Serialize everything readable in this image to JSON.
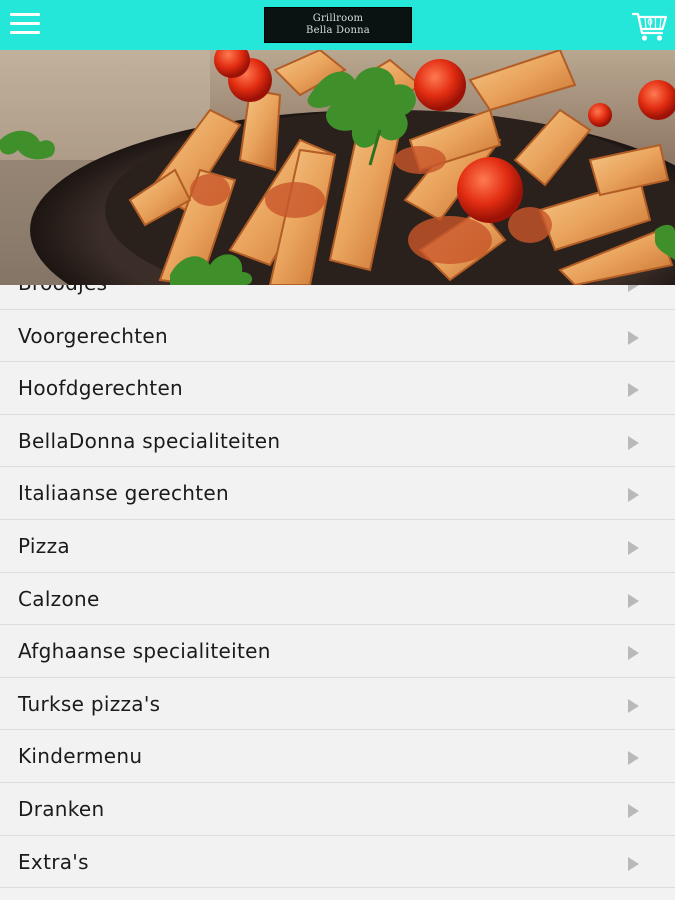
{
  "header": {
    "logo_line1": "Grillroom",
    "logo_line2": "Bella Donna",
    "cart_count": "0",
    "menu_icon": "hamburger-menu-icon",
    "cart_icon": "shopping-cart-icon"
  },
  "colors": {
    "topbar": "#24e6d9",
    "list_background": "#f2f2f2",
    "divider": "#dcdcdc",
    "arrow": "#b9b9b9"
  },
  "categories": [
    {
      "label": "Broodjes"
    },
    {
      "label": "Voorgerechten"
    },
    {
      "label": "Hoofdgerechten"
    },
    {
      "label": "BellaDonna specialiteiten"
    },
    {
      "label": "Italiaanse gerechten"
    },
    {
      "label": "Pizza"
    },
    {
      "label": "Calzone"
    },
    {
      "label": "Afghaanse specialiteiten"
    },
    {
      "label": "Turkse pizza's"
    },
    {
      "label": "Kindermenu"
    },
    {
      "label": "Dranken"
    },
    {
      "label": "Extra's"
    }
  ]
}
